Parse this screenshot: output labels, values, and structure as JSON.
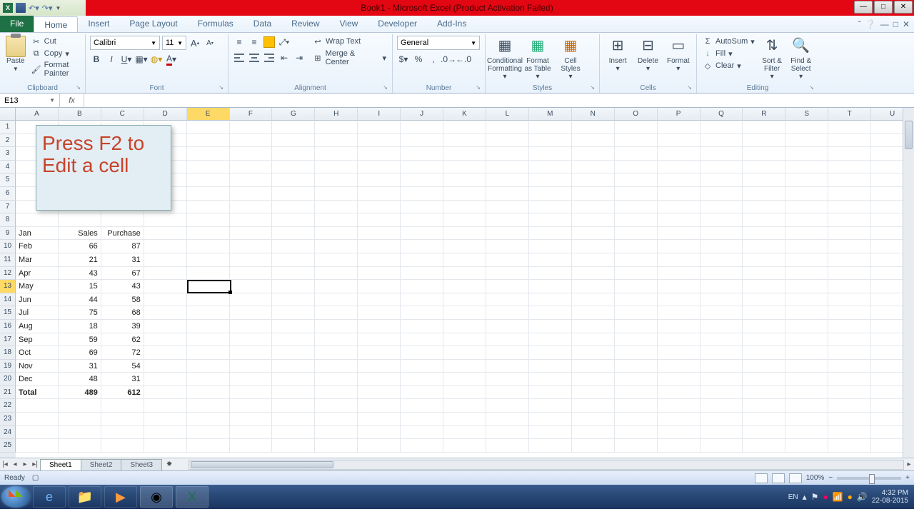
{
  "title": "Book1 - Microsoft Excel (Product Activation Failed)",
  "tabs": {
    "file": "File",
    "list": [
      "Home",
      "Insert",
      "Page Layout",
      "Formulas",
      "Data",
      "Review",
      "View",
      "Developer",
      "Add-Ins"
    ],
    "active": "Home"
  },
  "clipboard": {
    "label": "Clipboard",
    "paste": "Paste",
    "cut": "Cut",
    "copy": "Copy ",
    "fmt": "Format Painter"
  },
  "font": {
    "label": "Font",
    "name": "Calibri",
    "size": "11"
  },
  "alignment": {
    "label": "Alignment",
    "wrap": "Wrap Text",
    "merge": "Merge & Center "
  },
  "number": {
    "label": "Number",
    "format": "General"
  },
  "styles": {
    "label": "Styles",
    "cond": "Conditional Formatting ",
    "table": "Format as Table ",
    "cell": "Cell Styles "
  },
  "cells": {
    "label": "Cells",
    "insert": "Insert",
    "delete": "Delete",
    "format": "Format"
  },
  "editing": {
    "label": "Editing",
    "sum": "AutoSum ",
    "fill": "Fill ",
    "clear": "Clear ",
    "sort": "Sort & Filter ",
    "find": "Find & Select "
  },
  "namebox": "E13",
  "note_l1": "Press F2 to",
  "note_l2": "Edit a cell",
  "columns": [
    "A",
    "B",
    "C",
    "D",
    "E",
    "F",
    "G",
    "H",
    "I",
    "J",
    "K",
    "L",
    "M",
    "N",
    "O",
    "P",
    "Q",
    "R",
    "S",
    "T",
    "U"
  ],
  "rownums": [
    1,
    2,
    3,
    4,
    5,
    6,
    7,
    8,
    9,
    10,
    11,
    12,
    13,
    14,
    15,
    16,
    17,
    18,
    19,
    20,
    21,
    22,
    23,
    24,
    25
  ],
  "tableHeader": {
    "a": "Jan",
    "b": "Sales",
    "c": "Purchase"
  },
  "tableRows": [
    {
      "a": "Feb",
      "b": "66",
      "c": "87"
    },
    {
      "a": "Mar",
      "b": "21",
      "c": "31"
    },
    {
      "a": "Apr",
      "b": "43",
      "c": "67"
    },
    {
      "a": "May",
      "b": "15",
      "c": "43"
    },
    {
      "a": "Jun",
      "b": "44",
      "c": "58"
    },
    {
      "a": "Jul",
      "b": "75",
      "c": "68"
    },
    {
      "a": "Aug",
      "b": "18",
      "c": "39"
    },
    {
      "a": "Sep",
      "b": "59",
      "c": "62"
    },
    {
      "a": "Oct",
      "b": "69",
      "c": "72"
    },
    {
      "a": "Nov",
      "b": "31",
      "c": "54"
    },
    {
      "a": "Dec",
      "b": "48",
      "c": "31"
    }
  ],
  "totalRow": {
    "a": "Total",
    "b": "489",
    "c": "612"
  },
  "sheets": [
    "Sheet1",
    "Sheet2",
    "Sheet3"
  ],
  "status": {
    "ready": "Ready",
    "zoom": "100%"
  },
  "tray": {
    "lang": "EN",
    "time": "4:32 PM",
    "date": "22-08-2015"
  }
}
